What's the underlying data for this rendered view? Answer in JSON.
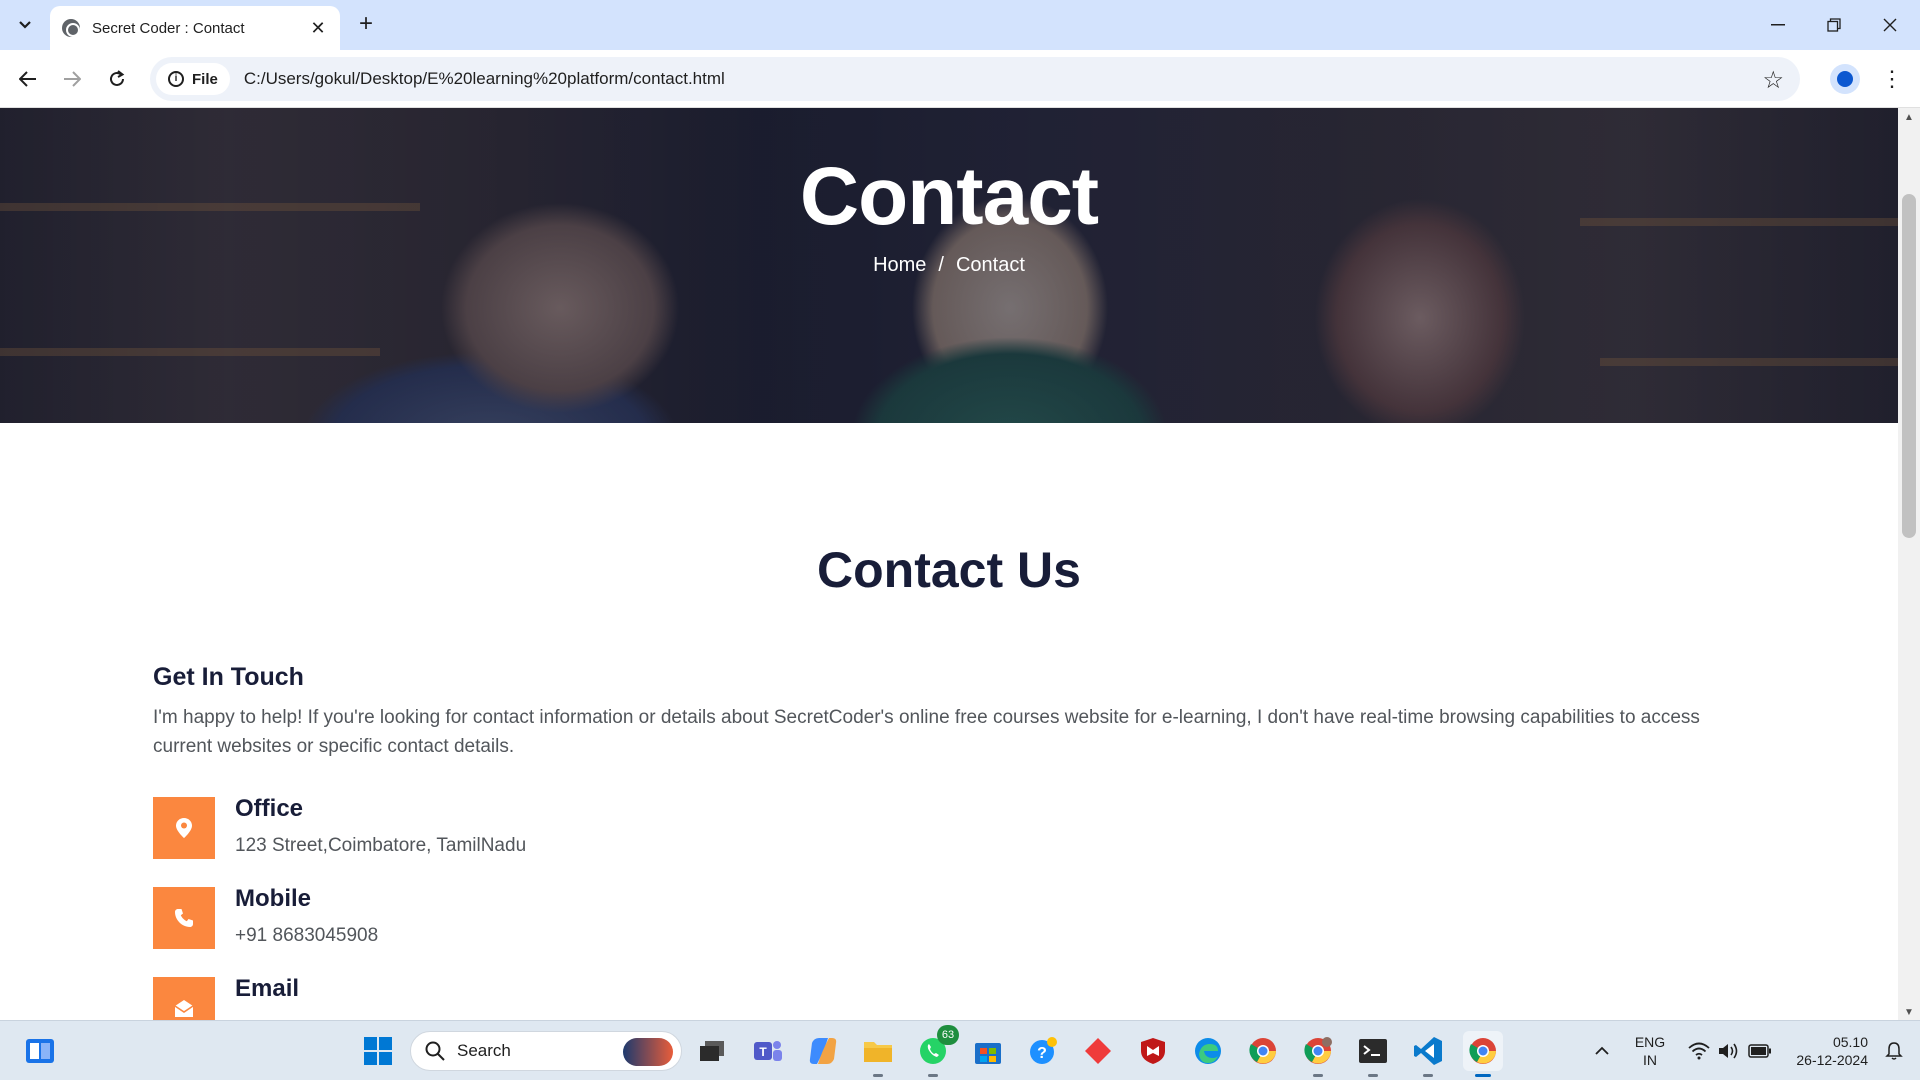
{
  "browser": {
    "tab_title": "Secret Coder : Contact",
    "site_chip": "File",
    "url": "C:/Users/gokul/Desktop/E%20learning%20platform/contact.html"
  },
  "hero": {
    "title": "Contact",
    "breadcrumb": {
      "home": "Home",
      "separator": "/",
      "current": "Contact"
    }
  },
  "contact_section": {
    "title": "Contact Us",
    "get_in_touch_title": "Get In Touch",
    "get_in_touch_text": "I'm happy to help! If you're looking for contact information or details about SecretCoder's online free courses website for e-learning, I don't have real-time browsing capabilities to access current websites or specific contact details.",
    "items": [
      {
        "label": "Office",
        "value": "123 Street,Coimbatore, TamilNadu",
        "icon": "map-marker-icon"
      },
      {
        "label": "Mobile",
        "value": "+91 8683045908",
        "icon": "phone-icon"
      },
      {
        "label": "Email",
        "value": "",
        "icon": "envelope-open-icon"
      }
    ],
    "accent_color": "#fb873f",
    "heading_color": "#181d38"
  },
  "taskbar": {
    "search_label": "Search",
    "whatsapp_badge": "63",
    "language": "ENG",
    "region": "IN",
    "time": "05.10",
    "date": "26-12-2024"
  }
}
